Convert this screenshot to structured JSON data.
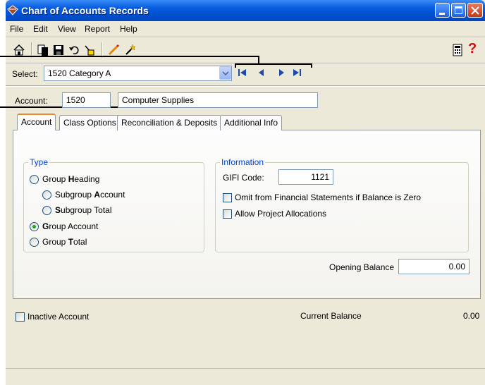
{
  "window": {
    "title": "Chart of Accounts Records"
  },
  "menu": [
    "File",
    "Edit",
    "View",
    "Report",
    "Help"
  ],
  "help_glyph": "?",
  "select": {
    "label": "Select:",
    "value": "1520 Category A"
  },
  "account": {
    "label": "Account:",
    "number": "1520",
    "name": "Computer Supplies"
  },
  "tabs": [
    "Account",
    "Class Options",
    "Reconciliation & Deposits",
    "Additional Info"
  ],
  "type_group": {
    "legend": "Type",
    "options": [
      {
        "pre": "Group ",
        "key": "H",
        "post": "eading",
        "checked": false
      },
      {
        "pre": "Subgroup ",
        "key": "A",
        "post": "ccount",
        "checked": false
      },
      {
        "pre": "",
        "key": "S",
        "post": "ubgroup Total",
        "checked": false
      },
      {
        "pre": "",
        "key": "G",
        "post": "roup Account",
        "checked": true
      },
      {
        "pre": "Group ",
        "key": "T",
        "post": "otal",
        "checked": false
      }
    ]
  },
  "info_group": {
    "legend": "Information",
    "gifi_label": "GIFI Code:",
    "gifi_value": "1121",
    "omit_label": "Omit from Financial Statements if Balance is Zero",
    "allow_label": "Allow Project Allocations"
  },
  "opening_balance": {
    "label": "Opening Balance",
    "value": "0.00"
  },
  "inactive_label": "Inactive Account",
  "current_balance": {
    "label": "Current Balance",
    "value": "0.00"
  },
  "colors": {
    "title_bar": "#0a5fe0",
    "window_bg": "#ece9d8",
    "legend": "#0046d5",
    "radio_dot": "#21a121"
  },
  "icons": [
    "home-icon",
    "copy-icon",
    "save-icon",
    "undo-icon",
    "cleanup-icon",
    "pencil-icon",
    "wand-icon",
    "calculator-icon",
    "help-icon"
  ]
}
